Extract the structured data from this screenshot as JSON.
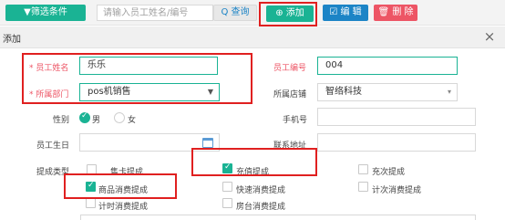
{
  "toolbar": {
    "filter_label": "▼筛选条件",
    "search_placeholder": "请输入员工姓名/编号",
    "query_label": "Q 查询",
    "add_label": "⊕ 添加",
    "edit_label": "☑ 编 辑",
    "delete_label": "🗑 删 除"
  },
  "dialog": {
    "title": "添加",
    "close_glyph": "×"
  },
  "form": {
    "name_label": "* 员工姓名",
    "name_value": "乐乐",
    "number_label": "员工编号",
    "number_value": "004",
    "dept_label": "* 所属部门",
    "dept_value": "pos机销售",
    "store_label": "所属店铺",
    "store_value": "智络科技",
    "gender_label": "性别",
    "gender_male": "男",
    "gender_female": "女",
    "phone_label": "手机号",
    "birthday_label": "员工生日",
    "address_label": "联系地址",
    "commission_label": "提成类型",
    "commission_options": [
      {
        "label": "售卡提成",
        "checked": false
      },
      {
        "label": "充值提成",
        "checked": true
      },
      {
        "label": "充次提成",
        "checked": false
      },
      {
        "label": "商品消费提成",
        "checked": true
      },
      {
        "label": "快速消费提成",
        "checked": false
      },
      {
        "label": "计次消费提成",
        "checked": false
      },
      {
        "label": "计时消费提成",
        "checked": false
      },
      {
        "label": "房台消费提成",
        "checked": false
      }
    ]
  },
  "colors": {
    "primary_green": "#1ab394",
    "edit_blue": "#1c84c6",
    "delete_red": "#ed5565",
    "highlight_red": "#e02020"
  }
}
